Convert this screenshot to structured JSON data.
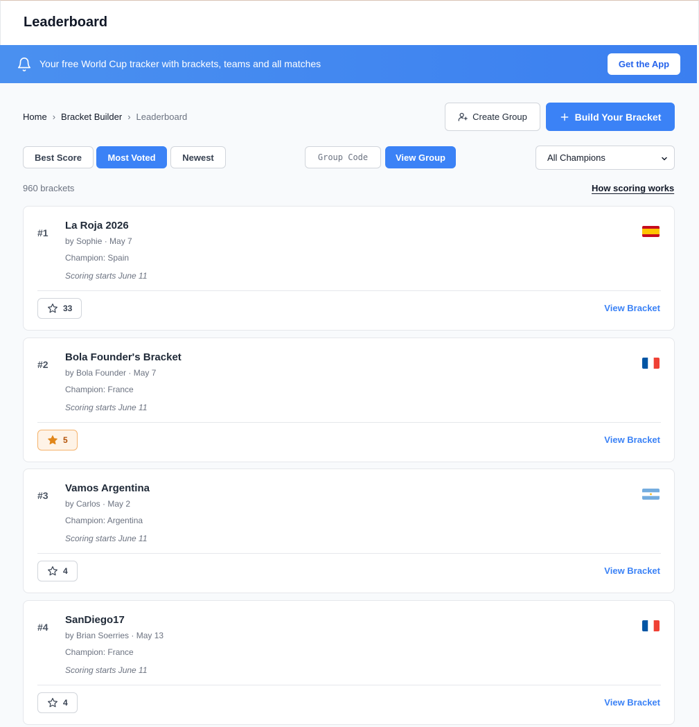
{
  "header": {
    "title": "Leaderboard"
  },
  "banner": {
    "text": "Your free World Cup tracker with brackets, teams and all matches",
    "cta": "Get the App"
  },
  "breadcrumb": {
    "items": [
      "Home",
      "Bracket Builder",
      "Leaderboard"
    ],
    "separator": "›"
  },
  "actions": {
    "create_group": "Create Group",
    "build_bracket": "Build Your Bracket"
  },
  "sort_tabs": [
    {
      "label": "Best Score",
      "active": false
    },
    {
      "label": "Most Voted",
      "active": true
    },
    {
      "label": "Newest",
      "active": false
    }
  ],
  "group": {
    "placeholder": "Group Code",
    "value": "",
    "button": "View Group"
  },
  "champion_filter": {
    "selected": "All Champions"
  },
  "summary": {
    "count": "960 brackets",
    "scoring_link": "How scoring works"
  },
  "view_label": "View Bracket",
  "brackets": [
    {
      "rank": "#1",
      "title": "La Roja 2026",
      "meta": "by Sophie · May 7",
      "champion": "Champion: Spain",
      "scoring": "Scoring starts June 11",
      "flag": "spain-flag",
      "votes": "33",
      "voted": false
    },
    {
      "rank": "#2",
      "title": "Bola Founder's Bracket",
      "meta": "by Bola Founder · May 7",
      "champion": "Champion: France",
      "scoring": "Scoring starts June 11",
      "flag": "france-flag",
      "votes": "5",
      "voted": true
    },
    {
      "rank": "#3",
      "title": "Vamos Argentina",
      "meta": "by Carlos · May 2",
      "champion": "Champion: Argentina",
      "scoring": "Scoring starts June 11",
      "flag": "argentina-flag",
      "votes": "4",
      "voted": false
    },
    {
      "rank": "#4",
      "title": "SanDiego17",
      "meta": "by Brian Soerries · May 13",
      "champion": "Champion: France",
      "scoring": "Scoring starts June 11",
      "flag": "france-flag",
      "votes": "4",
      "voted": false
    }
  ],
  "colors": {
    "primary": "#3b82f6",
    "banner": "#3b82f6",
    "voted_bg": "#fef3e7",
    "voted_star": "#e0861a"
  }
}
